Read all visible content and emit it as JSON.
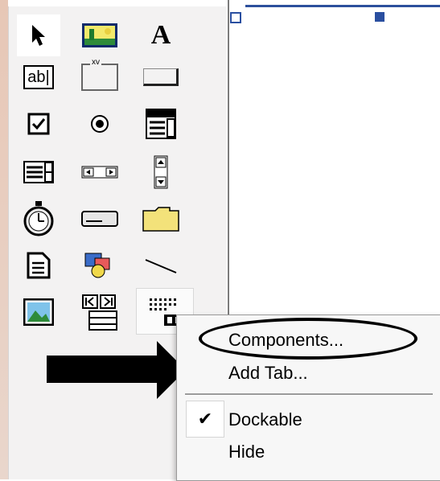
{
  "toolbox": {
    "tools": [
      {
        "name": "pointer-tool",
        "icon": "arrow-pointer-icon"
      },
      {
        "name": "picturebox-tool",
        "icon": "picture-icon"
      },
      {
        "name": "label-tool",
        "icon": "label-a-icon",
        "glyph": "A"
      },
      {
        "name": "textbox-tool",
        "icon": "textbox-icon",
        "glyph": "ab|"
      },
      {
        "name": "frame-tool",
        "icon": "frame-icon",
        "glyph": "xv"
      },
      {
        "name": "commandbutton-tool",
        "icon": "button-icon"
      },
      {
        "name": "checkbox-tool",
        "icon": "checkbox-icon"
      },
      {
        "name": "optionbutton-tool",
        "icon": "radio-icon"
      },
      {
        "name": "combobox-tool",
        "icon": "combobox-icon"
      },
      {
        "name": "listbox-tool",
        "icon": "listbox-icon"
      },
      {
        "name": "hscrollbar-tool",
        "icon": "hscroll-icon"
      },
      {
        "name": "vscrollbar-tool",
        "icon": "vscroll-icon"
      },
      {
        "name": "timer-tool",
        "icon": "stopwatch-icon"
      },
      {
        "name": "drivelistbox-tool",
        "icon": "drive-icon"
      },
      {
        "name": "dirlistbox-tool",
        "icon": "folder-icon"
      },
      {
        "name": "filelistbox-tool",
        "icon": "file-icon"
      },
      {
        "name": "shape-tool",
        "icon": "shapes-icon"
      },
      {
        "name": "line-tool",
        "icon": "line-icon"
      },
      {
        "name": "image-tool",
        "icon": "image-icon"
      },
      {
        "name": "data-tool",
        "icon": "data-control-icon"
      },
      {
        "name": "ole-tool",
        "icon": "ole-icon"
      }
    ]
  },
  "context_menu": {
    "components": "Components...",
    "add_tab": "Add Tab...",
    "dockable": "Dockable",
    "dockable_checked": true,
    "hide": "Hide",
    "check_glyph": "✔"
  },
  "colors": {
    "accent": "#2a4fa0",
    "toolbox_bg": "#f3f2f2"
  }
}
